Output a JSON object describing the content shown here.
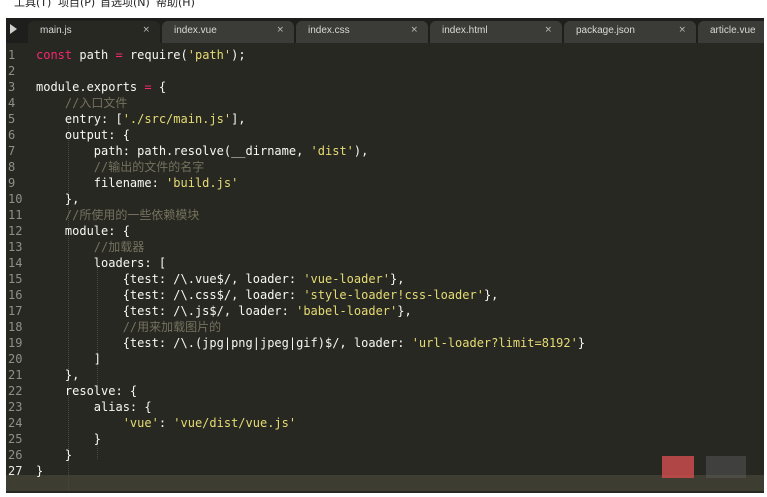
{
  "menu": [
    "工具(T)",
    "项目(P)",
    "首选项(N)",
    "帮助(H)"
  ],
  "tabs": [
    {
      "label": "main.js",
      "close": "×",
      "active": true
    },
    {
      "label": "index.vue",
      "close": "×",
      "active": false
    },
    {
      "label": "index.css",
      "close": "×",
      "active": false
    },
    {
      "label": "index.html",
      "close": "×",
      "active": false
    },
    {
      "label": "package.json",
      "close": "×",
      "active": false
    },
    {
      "label": "article.vue",
      "close": "",
      "active": false
    }
  ],
  "line_numbers": [
    "1",
    "2",
    "3",
    "4",
    "5",
    "6",
    "7",
    "8",
    "9",
    "10",
    "11",
    "12",
    "13",
    "14",
    "15",
    "16",
    "17",
    "18",
    "19",
    "20",
    "21",
    "22",
    "23",
    "24",
    "25",
    "26",
    "27"
  ],
  "current_line": "27",
  "code": [
    [
      {
        "t": "const",
        "c": "kw"
      },
      {
        "t": " path "
      },
      {
        "t": "=",
        "c": "kw"
      },
      {
        "t": " require("
      },
      {
        "t": "'path'",
        "c": "str"
      },
      {
        "t": ");"
      }
    ],
    [],
    [
      {
        "t": "module.exports "
      },
      {
        "t": "=",
        "c": "kw"
      },
      {
        "t": " {"
      }
    ],
    [
      {
        "t": "    "
      },
      {
        "t": "//入口文件",
        "c": "cm"
      }
    ],
    [
      {
        "t": "    entry: ["
      },
      {
        "t": "'./src/main.js'",
        "c": "str"
      },
      {
        "t": "],"
      }
    ],
    [
      {
        "t": "    output: {"
      }
    ],
    [
      {
        "t": "        path: path.resolve(__dirname, "
      },
      {
        "t": "'dist'",
        "c": "str"
      },
      {
        "t": "),"
      }
    ],
    [
      {
        "t": "        "
      },
      {
        "t": "//输出的文件的名字",
        "c": "cm"
      }
    ],
    [
      {
        "t": "        filename: "
      },
      {
        "t": "'build.js'",
        "c": "str"
      }
    ],
    [
      {
        "t": "    },"
      }
    ],
    [
      {
        "t": "    "
      },
      {
        "t": "//所使用的一些依赖模块",
        "c": "cm"
      }
    ],
    [
      {
        "t": "    module: {"
      }
    ],
    [
      {
        "t": "        "
      },
      {
        "t": "//加载器",
        "c": "cm"
      }
    ],
    [
      {
        "t": "        loaders: ["
      }
    ],
    [
      {
        "t": "            {test: /\\.vue$/, loader: "
      },
      {
        "t": "'vue-loader'",
        "c": "str"
      },
      {
        "t": "},"
      }
    ],
    [
      {
        "t": "            {test: /\\.css$/, loader: "
      },
      {
        "t": "'style-loader!css-loader'",
        "c": "str"
      },
      {
        "t": "},"
      }
    ],
    [
      {
        "t": "            {test: /\\.js$/, loader: "
      },
      {
        "t": "'babel-loader'",
        "c": "str"
      },
      {
        "t": "},"
      }
    ],
    [
      {
        "t": "            "
      },
      {
        "t": "//用来加载图片的",
        "c": "cm"
      }
    ],
    [
      {
        "t": "            {test: /\\.(jpg|png|jpeg|gif)$/, loader: "
      },
      {
        "t": "'url-loader?limit=8192'",
        "c": "str"
      },
      {
        "t": "}"
      }
    ],
    [
      {
        "t": "        ]"
      }
    ],
    [
      {
        "t": "    },"
      }
    ],
    [
      {
        "t": "    resolve: {"
      }
    ],
    [
      {
        "t": "        alias: {"
      }
    ],
    [
      {
        "t": "            "
      },
      {
        "t": "'vue'",
        "c": "str"
      },
      {
        "t": ": "
      },
      {
        "t": "'vue/dist/vue.js'",
        "c": "str"
      }
    ],
    [
      {
        "t": "        }"
      }
    ],
    [
      {
        "t": "    }"
      }
    ],
    [
      {
        "t": "}"
      }
    ]
  ],
  "colors": {
    "background": "#272822",
    "keyword": "#f92672",
    "string": "#e6db74",
    "comment": "#75715e",
    "text": "#f8f8f2"
  }
}
